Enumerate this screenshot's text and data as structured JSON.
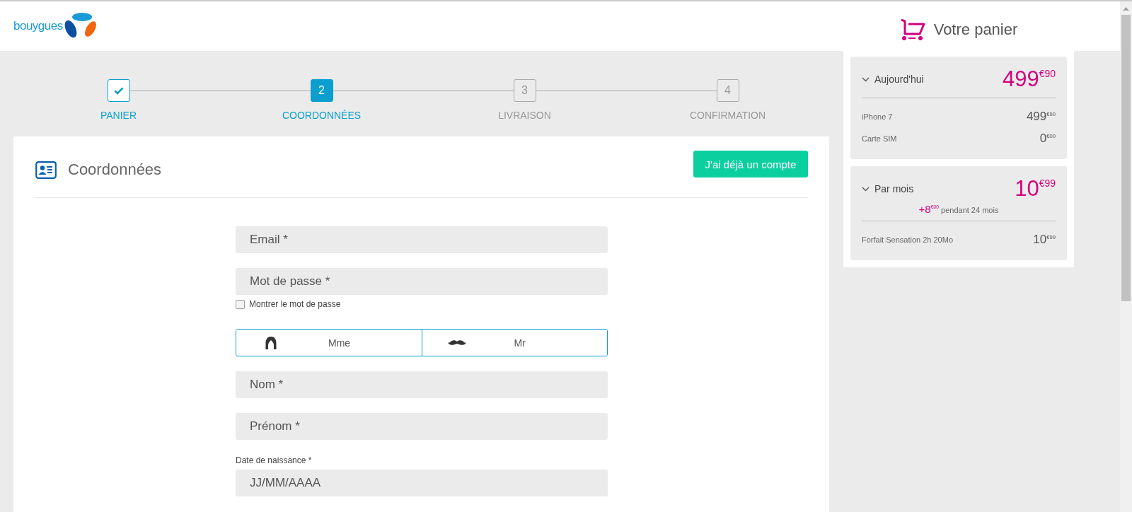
{
  "header": {
    "logo": {
      "brand": "bouygues"
    },
    "cart_title": "Votre panier"
  },
  "steps": [
    {
      "label": "PANIER",
      "completed": true,
      "selected": false
    },
    {
      "number": "2",
      "label": "COORDONNÉES",
      "completed": false,
      "selected": true
    },
    {
      "number": "3",
      "label": "LIVRAISON",
      "completed": false,
      "selected": false
    },
    {
      "number": "4",
      "label": "CONFIRMATION",
      "completed": false,
      "selected": false
    }
  ],
  "form": {
    "title": "Coordonnées",
    "account_button": "J'ai déjà un compte",
    "email": {
      "placeholder": "Email *"
    },
    "password": {
      "placeholder": "Mot de passe *"
    },
    "show_password": {
      "label": "Montrer le mot de passe",
      "checked": false
    },
    "civility": [
      {
        "label": "Mme",
        "kind": "female",
        "selected": false
      },
      {
        "label": "Mr",
        "kind": "male",
        "selected": false
      }
    ],
    "last_name": {
      "placeholder": "Nom *"
    },
    "first_name": {
      "placeholder": "Prénom *"
    },
    "birth_date": {
      "label": "Date de naissance *",
      "placeholder": "JJ/MM/AAAA"
    }
  },
  "cart": [
    {
      "title": "Aujourd'hui",
      "total": {
        "whole": "499",
        "cents": "€90"
      },
      "lines": [
        {
          "name": "iPhone 7",
          "price": {
            "whole": "499",
            "cents": "€90"
          }
        },
        {
          "name": "Carte SIM",
          "price": {
            "whole": "0",
            "cents": "€00"
          }
        }
      ]
    },
    {
      "title": "Par mois",
      "total": {
        "whole": "10",
        "cents": "€99"
      },
      "promo": {
        "whole": "+8",
        "cents": "€00",
        "text": "pendant 24 mois"
      },
      "lines": [
        {
          "name": "Forfait Sensation 2h 20Mo",
          "price": {
            "whole": "10",
            "cents": "€99"
          }
        }
      ]
    }
  ]
}
